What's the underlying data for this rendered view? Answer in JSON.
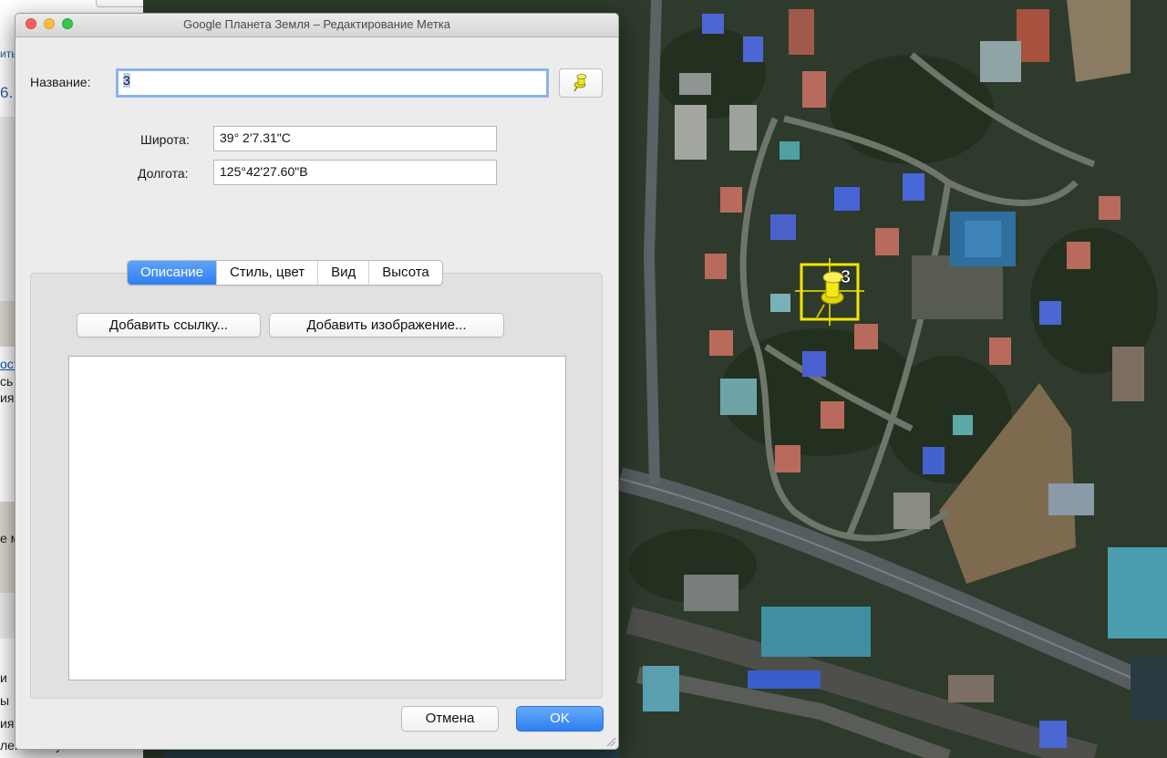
{
  "window": {
    "title": "Google Планета Земля – Редактирование Метка"
  },
  "placemark": {
    "name_label": "Название:",
    "name_value": "3",
    "latitude_label": "Широта:",
    "latitude_value": "39° 2'7.31\"С",
    "longitude_label": "Долгота:",
    "longitude_value": "125°42'27.60\"В",
    "icon": "yellow-pushpin-icon"
  },
  "tabs": [
    {
      "label": "Описание",
      "active": true
    },
    {
      "label": "Стиль, цвет",
      "active": false
    },
    {
      "label": "Вид",
      "active": false
    },
    {
      "label": "Высота",
      "active": false
    }
  ],
  "description": {
    "add_link_label": "Добавить ссылку...",
    "add_image_label": "Добавить изображение...",
    "text": ""
  },
  "footer": {
    "cancel_label": "Отмена",
    "ok_label": "OK"
  },
  "sidebar": {
    "top_fragment_1": "ить",
    "top_fragment_2": "6.",
    "link_fragment": "ост",
    "fragment_3": "сь",
    "fragment_4": "ия",
    "fragment_5": "е м",
    "list_fragments": [
      "и",
      "ы",
      "ия",
      "ленные пункты"
    ]
  },
  "map": {
    "placemark_label": "3",
    "accent": "#f3e600"
  },
  "colors": {
    "accent_blue": "#2f7ff2",
    "focus_ring": "#8ab4ea",
    "pin_yellow": "#f3e600"
  }
}
